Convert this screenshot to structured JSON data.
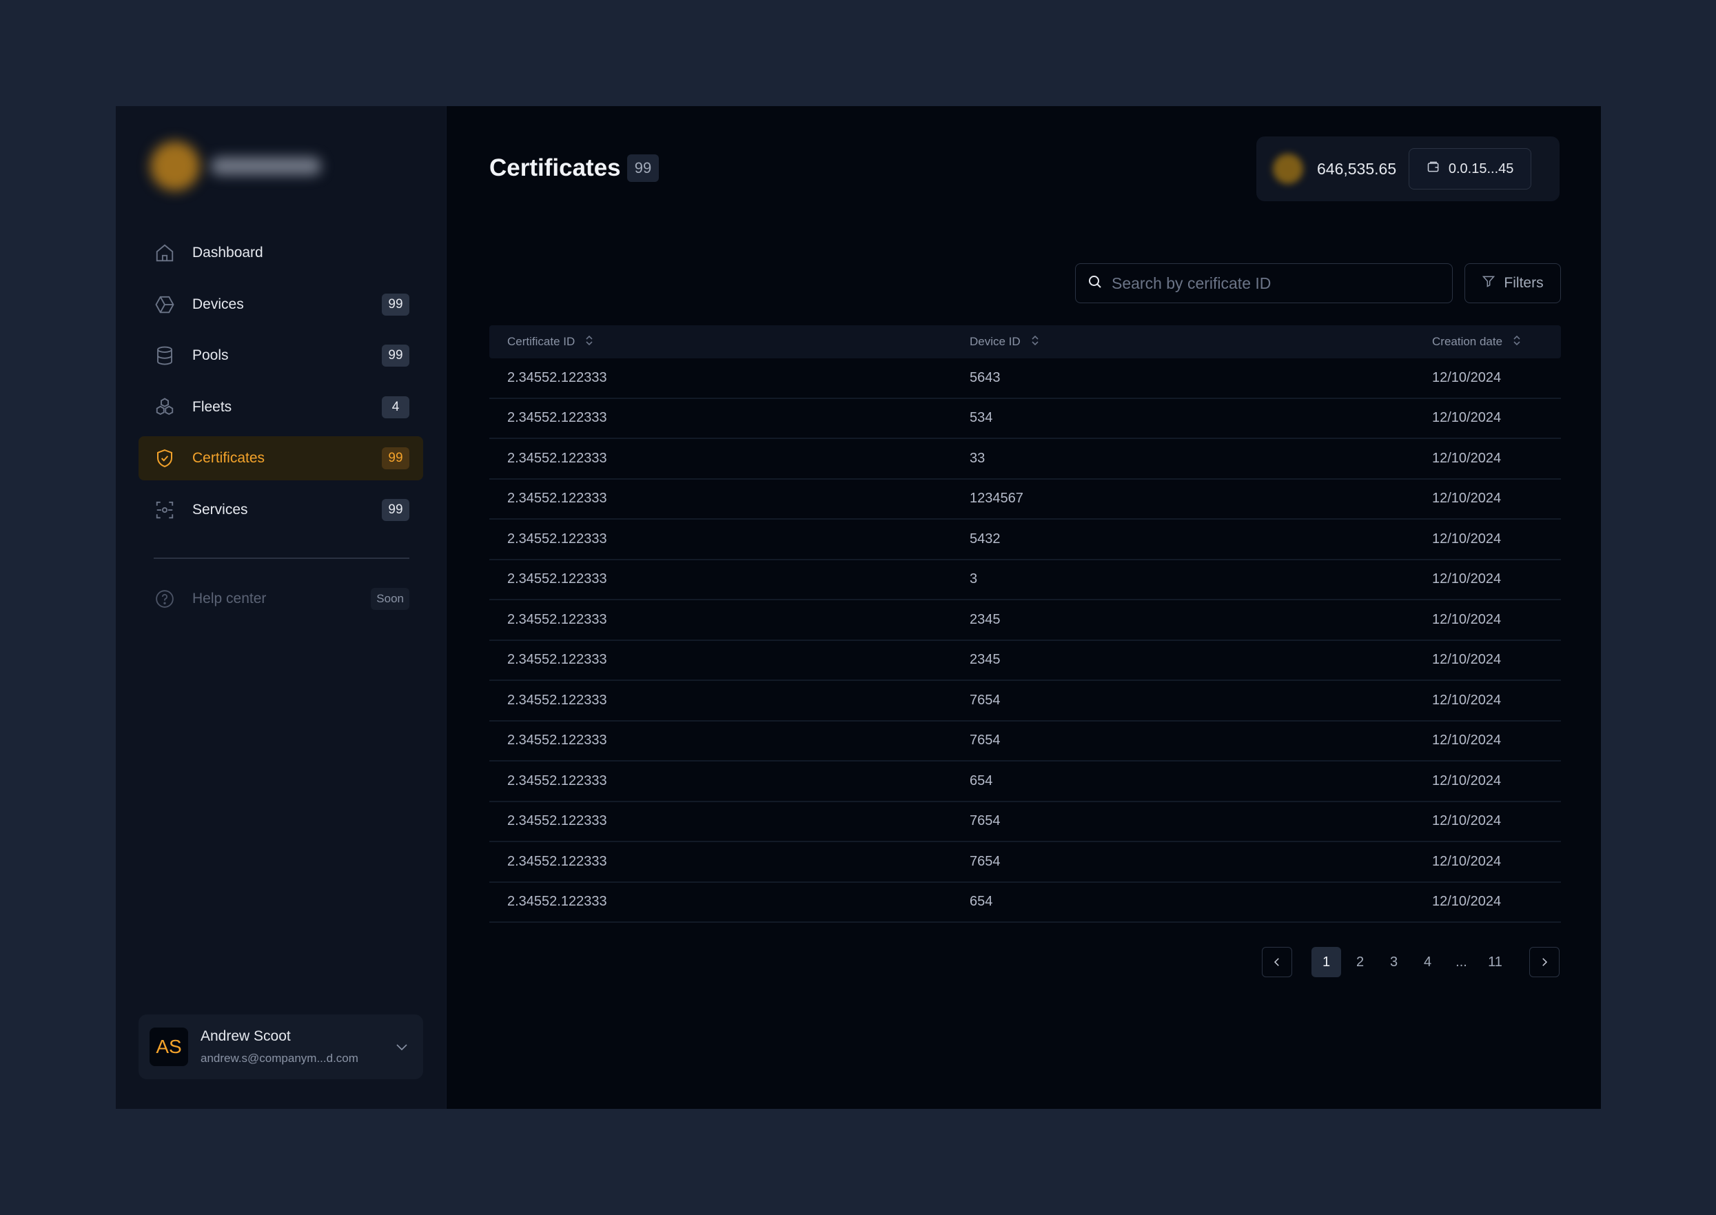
{
  "sidebar": {
    "items": [
      {
        "label": "Dashboard",
        "badge": "",
        "icon": "home-icon"
      },
      {
        "label": "Devices",
        "badge": "99",
        "icon": "hexagon-icon"
      },
      {
        "label": "Pools",
        "badge": "99",
        "icon": "database-icon"
      },
      {
        "label": "Fleets",
        "badge": "4",
        "icon": "cubes-icon"
      },
      {
        "label": "Certificates",
        "badge": "99",
        "icon": "shield-check-icon",
        "active": true
      },
      {
        "label": "Services",
        "badge": "99",
        "icon": "services-icon"
      }
    ],
    "help": {
      "label": "Help center",
      "tag": "Soon"
    },
    "user": {
      "initials": "AS",
      "name": "Andrew Scoot",
      "email": "andrew.s@companym...d.com"
    }
  },
  "header": {
    "title": "Certificates",
    "count": "99",
    "balance": "646,535.65",
    "wallet_address": "0.0.15...45"
  },
  "search": {
    "placeholder": "Search by cerificate ID",
    "value": ""
  },
  "filters_label": "Filters",
  "table": {
    "columns": [
      "Certificate ID",
      "Device ID",
      "Creation date"
    ],
    "rows": [
      [
        "2.34552.122333",
        "5643",
        "12/10/2024"
      ],
      [
        "2.34552.122333",
        "534",
        "12/10/2024"
      ],
      [
        "2.34552.122333",
        "33",
        "12/10/2024"
      ],
      [
        "2.34552.122333",
        "1234567",
        "12/10/2024"
      ],
      [
        "2.34552.122333",
        "5432",
        "12/10/2024"
      ],
      [
        "2.34552.122333",
        "3",
        "12/10/2024"
      ],
      [
        "2.34552.122333",
        "2345",
        "12/10/2024"
      ],
      [
        "2.34552.122333",
        "2345",
        "12/10/2024"
      ],
      [
        "2.34552.122333",
        "7654",
        "12/10/2024"
      ],
      [
        "2.34552.122333",
        "7654",
        "12/10/2024"
      ],
      [
        "2.34552.122333",
        "654",
        "12/10/2024"
      ],
      [
        "2.34552.122333",
        "7654",
        "12/10/2024"
      ],
      [
        "2.34552.122333",
        "7654",
        "12/10/2024"
      ],
      [
        "2.34552.122333",
        "654",
        "12/10/2024"
      ]
    ]
  },
  "pagination": {
    "pages": [
      "1",
      "2",
      "3",
      "4"
    ],
    "ellipsis": "...",
    "last": "11",
    "current": "1"
  },
  "colors": {
    "accent": "#f4a32b",
    "background": "#1b2436",
    "panel": "#03070f",
    "sidebar": "#0d1320"
  }
}
